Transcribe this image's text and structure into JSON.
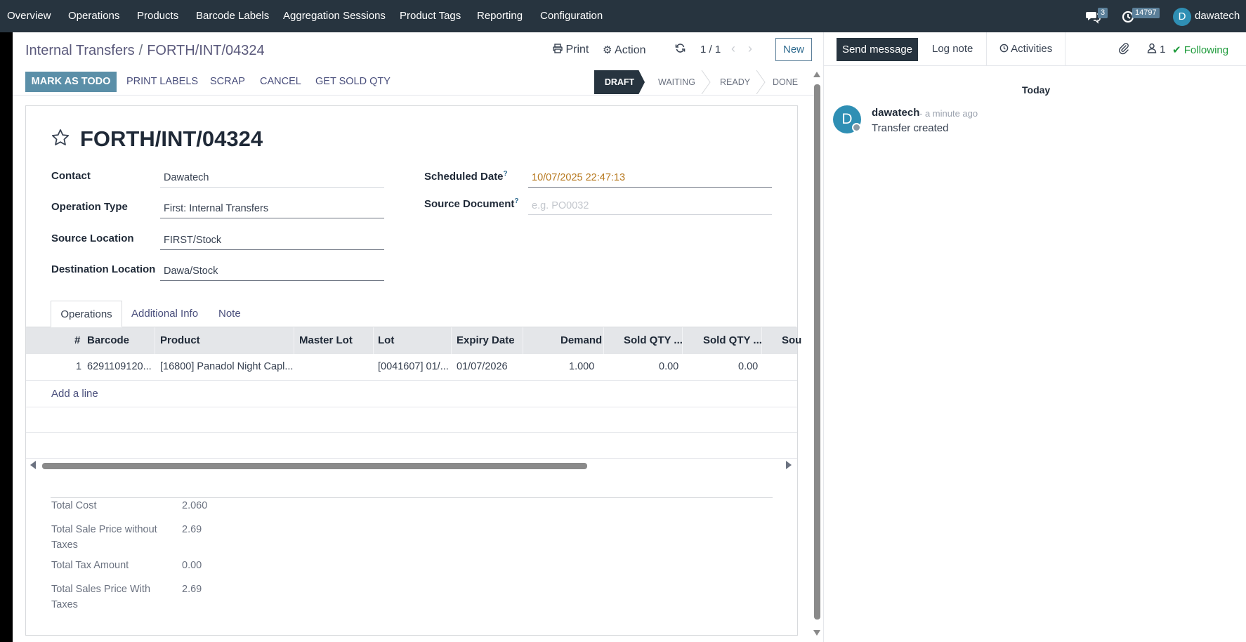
{
  "navbar": {
    "menus": [
      "Overview",
      "Operations",
      "Products",
      "Barcode Labels",
      "Aggregation Sessions",
      "Product Tags",
      "Reporting",
      "Configuration"
    ],
    "messages_badge": "3",
    "activities_badge": "14797",
    "user_initial": "D",
    "user_name": "dawatech"
  },
  "control_panel": {
    "breadcrumb_parent": "Internal Transfers",
    "breadcrumb_sep": "/",
    "breadcrumb_current": "FORTH/INT/04324",
    "print_label": "Print",
    "action_label": "Action",
    "pager": "1 / 1",
    "new_label": "New"
  },
  "statusbar": {
    "buttons": [
      "MARK AS TODO",
      "PRINT LABELS",
      "SCRAP",
      "CANCEL",
      "GET SOLD QTY"
    ],
    "stages": [
      "DRAFT",
      "WAITING",
      "READY",
      "DONE"
    ],
    "current_stage": "DRAFT"
  },
  "form": {
    "title": "FORTH/INT/04324",
    "contact_label": "Contact",
    "contact_value": "Dawatech",
    "operation_type_label": "Operation Type",
    "operation_type_value": "First: Internal Transfers",
    "source_location_label": "Source Location",
    "source_location_value": "FIRST/Stock",
    "destination_location_label": "Destination Location",
    "destination_location_value": "Dawa/Stock",
    "scheduled_date_label": "Scheduled Date",
    "scheduled_date_value": "10/07/2025 22:47:13",
    "source_document_label": "Source Document",
    "source_document_placeholder": "e.g. PO0032",
    "help_mark": "?"
  },
  "tabs": [
    "Operations",
    "Additional Info",
    "Note"
  ],
  "table": {
    "headers": [
      "#",
      "Barcode",
      "Product",
      "Master Lot",
      "Lot",
      "Expiry Date",
      "Demand",
      "Sold QTY ...",
      "Sold QTY ...",
      "Sou"
    ],
    "rows": [
      [
        "1",
        "6291109120...",
        "[16800] Panadol Night Capl...",
        "",
        "[0041607] 01/...",
        "01/07/2026",
        "1.000",
        "0.00",
        "0.00",
        ""
      ]
    ],
    "add_line": "Add a line"
  },
  "totals": {
    "total_cost_label": "Total Cost",
    "total_cost_value": "2.060",
    "sale_wo_tax_label": "Total Sale Price without Taxes",
    "sale_wo_tax_value": "2.69",
    "tax_label": "Total Tax Amount",
    "tax_value": "0.00",
    "sale_w_tax_label": "Total Sales Price With Taxes",
    "sale_w_tax_value": "2.69"
  },
  "chatter": {
    "send_message": "Send message",
    "log_note": "Log note",
    "activities": "Activities",
    "followers_count": "1",
    "following": "Following",
    "date_separator": "Today",
    "messages": [
      {
        "author": "dawatech",
        "time": "- a minute ago",
        "body": "Transfer created",
        "initial": "D"
      }
    ]
  },
  "colors": {
    "navbar": "#27343f",
    "primary": "#5b8fa8",
    "link": "#4a4f7c",
    "following": "#1e9b3b",
    "warning": "#b7791f"
  }
}
